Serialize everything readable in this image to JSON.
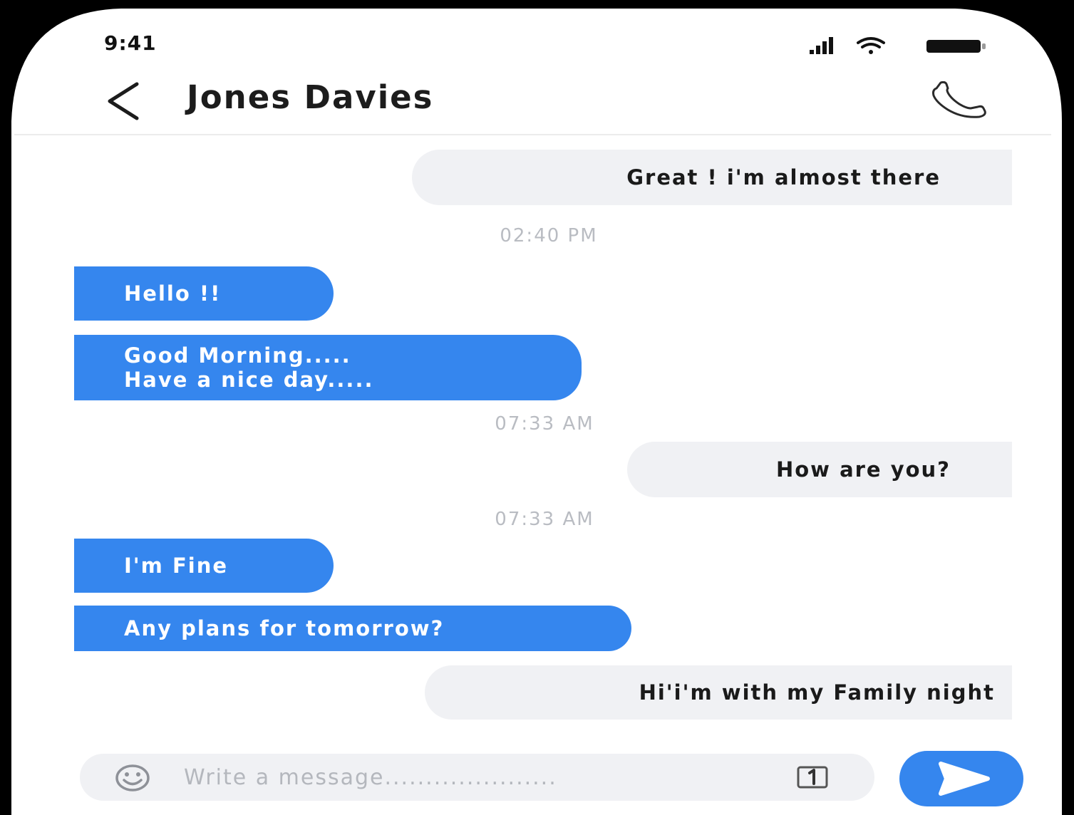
{
  "status_bar": {
    "time": "9:41",
    "icons": [
      "signal-icon",
      "wifi-icon",
      "battery-icon"
    ]
  },
  "header": {
    "back_icon": "chevron-left-icon",
    "contact_name": "Jones Davies",
    "call_icon": "phone-icon"
  },
  "colors": {
    "accent": "#3586ee",
    "incoming_bubble": "#3586ee",
    "outgoing_bubble": "#f0f1f4",
    "timestamp": "#b9bcc2"
  },
  "conversation": {
    "msg_1": "Great ! i'm almost there",
    "time_1": "02:40 PM",
    "msg_2": "Hello !!",
    "msg_3": "Good Morning.....\nHave a nice day.....",
    "time_2": "07:33 AM",
    "msg_4": "How are you?",
    "time_3": "07:33 AM",
    "msg_5": "I'm Fine",
    "msg_6": "Any plans for tomorrow?",
    "msg_7": "Hi'i'm with my Family night"
  },
  "composer": {
    "placeholder": "Write a message.....................",
    "emoji_icon": "smiley-icon",
    "attach_icon": "attachment-icon",
    "send_icon": "send-icon"
  }
}
